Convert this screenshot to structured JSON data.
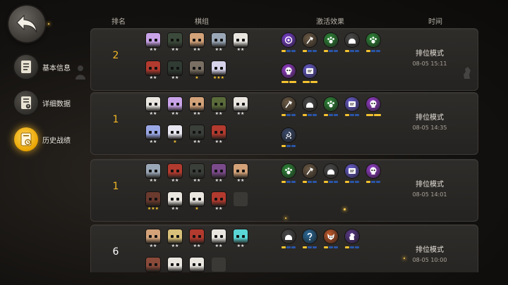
{
  "nav": {
    "items": [
      {
        "label": "基本信息",
        "icon": "document-icon",
        "active": false
      },
      {
        "label": "详细数据",
        "icon": "data-sheet-icon",
        "active": false
      },
      {
        "label": "历史战绩",
        "icon": "history-icon",
        "active": true
      }
    ]
  },
  "headers": {
    "rank": "排名",
    "lineup": "棋组",
    "traits": "激活效果",
    "time": "时间"
  },
  "colors": {
    "accent": "#f2c230",
    "rank_gold": "#f2b824",
    "rank_white": "#ffffff"
  },
  "matches": [
    {
      "rank": "2",
      "gold": true,
      "mode": "排位模式",
      "date": "08-05 15:11",
      "units": [
        {
          "color": "#c9a3e8",
          "stars": "★★",
          "star_color": "#e6e6e6"
        },
        {
          "color": "#3b4a3a",
          "stars": "★★",
          "star_color": "#e6e6e6"
        },
        {
          "color": "#d3a279",
          "stars": "★★",
          "star_color": "#e6e6e6"
        },
        {
          "color": "#9aa7b6",
          "stars": "★★",
          "star_color": "#e6e6e6"
        },
        {
          "color": "#e9e6e0",
          "stars": "★★",
          "star_color": "#e6e6e6"
        },
        {
          "color": "#b23a2e",
          "stars": "★★",
          "star_color": "#e6e6e6"
        },
        {
          "color": "#2f3b33",
          "stars": "★★",
          "star_color": "#e6e6e6"
        },
        {
          "color": "#7a6f63",
          "stars": "★",
          "star_color": "#f2c230"
        },
        {
          "color": "#d6d2ea",
          "stars": "★★★",
          "star_color": "#f2c230"
        }
      ],
      "traits": [
        {
          "color": "#7a3fd1",
          "icon": "spiral-icon",
          "tier": "#f2c230",
          "filled": 1,
          "total": 3
        },
        {
          "color": "#6b5a45",
          "icon": "axe-icon",
          "tier": "#f2c230",
          "filled": 1,
          "total": 3
        },
        {
          "color": "#2f8a3a",
          "icon": "paw-icon",
          "tier": "#f2c230",
          "filled": 1,
          "total": 3
        },
        {
          "color": "#4a4a4a",
          "icon": "helmet-icon",
          "tier": "#f2c230",
          "filled": 1,
          "total": 3
        },
        {
          "color": "#2f8a3a",
          "icon": "paw-icon",
          "tier": "#f2c230",
          "filled": 1,
          "total": 3
        },
        {
          "color": "#9a3fd1",
          "icon": "skull-icon",
          "tier": "#f2c230",
          "filled": 2,
          "total": 2
        },
        {
          "color": "#6a5fd1",
          "icon": "book-icon",
          "tier": "#f2c230",
          "filled": 2,
          "total": 2
        }
      ]
    },
    {
      "rank": "1",
      "gold": true,
      "mode": "排位模式",
      "date": "08-05 14:35",
      "units": [
        {
          "color": "#e9e6e0",
          "stars": "★★",
          "star_color": "#e6e6e6"
        },
        {
          "color": "#c9a3e8",
          "stars": "★★",
          "star_color": "#e6e6e6"
        },
        {
          "color": "#d3a279",
          "stars": "★★",
          "star_color": "#e6e6e6"
        },
        {
          "color": "#5a6b3a",
          "stars": "★★",
          "star_color": "#e6e6e6"
        },
        {
          "color": "#e9e6e0",
          "stars": "★★",
          "star_color": "#e6e6e6"
        },
        {
          "color": "#9aa7e6",
          "stars": "★★",
          "star_color": "#e6e6e6"
        },
        {
          "color": "#e8e6f0",
          "stars": "★",
          "star_color": "#f2c230"
        },
        {
          "color": "#3a3f3a",
          "stars": "★★",
          "star_color": "#e6e6e6"
        },
        {
          "color": "#b23a2e",
          "stars": "★★",
          "star_color": "#e6e6e6"
        }
      ],
      "traits": [
        {
          "color": "#6b5a45",
          "icon": "axe-icon",
          "tier": "#f2c230",
          "filled": 1,
          "total": 3
        },
        {
          "color": "#4a4a4a",
          "icon": "helmet-icon",
          "tier": "#f2c230",
          "filled": 1,
          "total": 3
        },
        {
          "color": "#2f8a3a",
          "icon": "paw-icon",
          "tier": "#f2c230",
          "filled": 1,
          "total": 3
        },
        {
          "color": "#6a5fd1",
          "icon": "book-icon",
          "tier": "#f2c230",
          "filled": 1,
          "total": 3
        },
        {
          "color": "#9a3fd1",
          "icon": "skull-icon",
          "tier": "#f2c230",
          "filled": 2,
          "total": 2
        },
        {
          "color": "#3a4a6a",
          "icon": "swirl-icon",
          "tier": "#f2c230",
          "filled": 1,
          "total": 3
        }
      ]
    },
    {
      "rank": "1",
      "gold": true,
      "mode": "排位模式",
      "date": "08-05 14:01",
      "units": [
        {
          "color": "#9aa7b6",
          "stars": "★★",
          "star_color": "#e6e6e6"
        },
        {
          "color": "#b23a2e",
          "stars": "★★",
          "star_color": "#e6e6e6"
        },
        {
          "color": "#3a3f3a",
          "stars": "★★",
          "star_color": "#e6e6e6"
        },
        {
          "color": "#7a4a8a",
          "stars": "★★",
          "star_color": "#e6e6e6"
        },
        {
          "color": "#d3a279",
          "stars": "★★",
          "star_color": "#e6e6e6"
        },
        {
          "color": "#6a3a2e",
          "stars": "★★★",
          "star_color": "#f2c230"
        },
        {
          "color": "#e9e6e0",
          "stars": "★★",
          "star_color": "#e6e6e6"
        },
        {
          "color": "#e9e6e0",
          "stars": "★",
          "star_color": "#f2c230"
        },
        {
          "color": "#b23a2e",
          "stars": "★★",
          "star_color": "#e6e6e6"
        },
        {
          "color": "",
          "stars": "",
          "star_color": ""
        }
      ],
      "traits": [
        {
          "color": "#2f8a3a",
          "icon": "paw-icon",
          "tier": "#f2c230",
          "filled": 1,
          "total": 3
        },
        {
          "color": "#6b5a45",
          "icon": "axe-icon",
          "tier": "#f2c230",
          "filled": 1,
          "total": 3
        },
        {
          "color": "#4a4a4a",
          "icon": "helmet-icon",
          "tier": "#f2c230",
          "filled": 1,
          "total": 3
        },
        {
          "color": "#6a5fd1",
          "icon": "book-icon",
          "tier": "#f2c230",
          "filled": 1,
          "total": 3
        },
        {
          "color": "#9a3fd1",
          "icon": "skull-icon",
          "tier": "#f2c230",
          "filled": 1,
          "total": 3
        }
      ]
    },
    {
      "rank": "6",
      "gold": false,
      "mode": "排位模式",
      "date": "08-05 10:00",
      "units": [
        {
          "color": "#d3a279",
          "stars": "★★",
          "star_color": "#e6e6e6"
        },
        {
          "color": "#d9c07a",
          "stars": "★★",
          "star_color": "#e6e6e6"
        },
        {
          "color": "#b23a2e",
          "stars": "★★",
          "star_color": "#e6e6e6"
        },
        {
          "color": "#e9e6e0",
          "stars": "★★",
          "star_color": "#e6e6e6"
        },
        {
          "color": "#5ad6d6",
          "stars": "★★",
          "star_color": "#e6e6e6"
        },
        {
          "color": "#8a4a3a",
          "stars": "",
          "star_color": "#e6e6e6"
        },
        {
          "color": "#e9e6e0",
          "stars": "",
          "star_color": "#e6e6e6"
        },
        {
          "color": "#e9e6e0",
          "stars": "",
          "star_color": "#e6e6e6"
        },
        {
          "color": "",
          "stars": "",
          "star_color": ""
        }
      ],
      "traits": [
        {
          "color": "#4a4a4a",
          "icon": "helmet-icon",
          "tier": "#f2c230",
          "filled": 1,
          "total": 3
        },
        {
          "color": "#2a6a9a",
          "icon": "question-icon",
          "tier": "#f2c230",
          "filled": 1,
          "total": 3
        },
        {
          "color": "#c25a2a",
          "icon": "fox-icon",
          "tier": "#f2c230",
          "filled": 1,
          "total": 3
        },
        {
          "color": "#5a3a8a",
          "icon": "knight-icon",
          "tier": "#f2c230",
          "filled": 1,
          "total": 3
        }
      ]
    }
  ]
}
